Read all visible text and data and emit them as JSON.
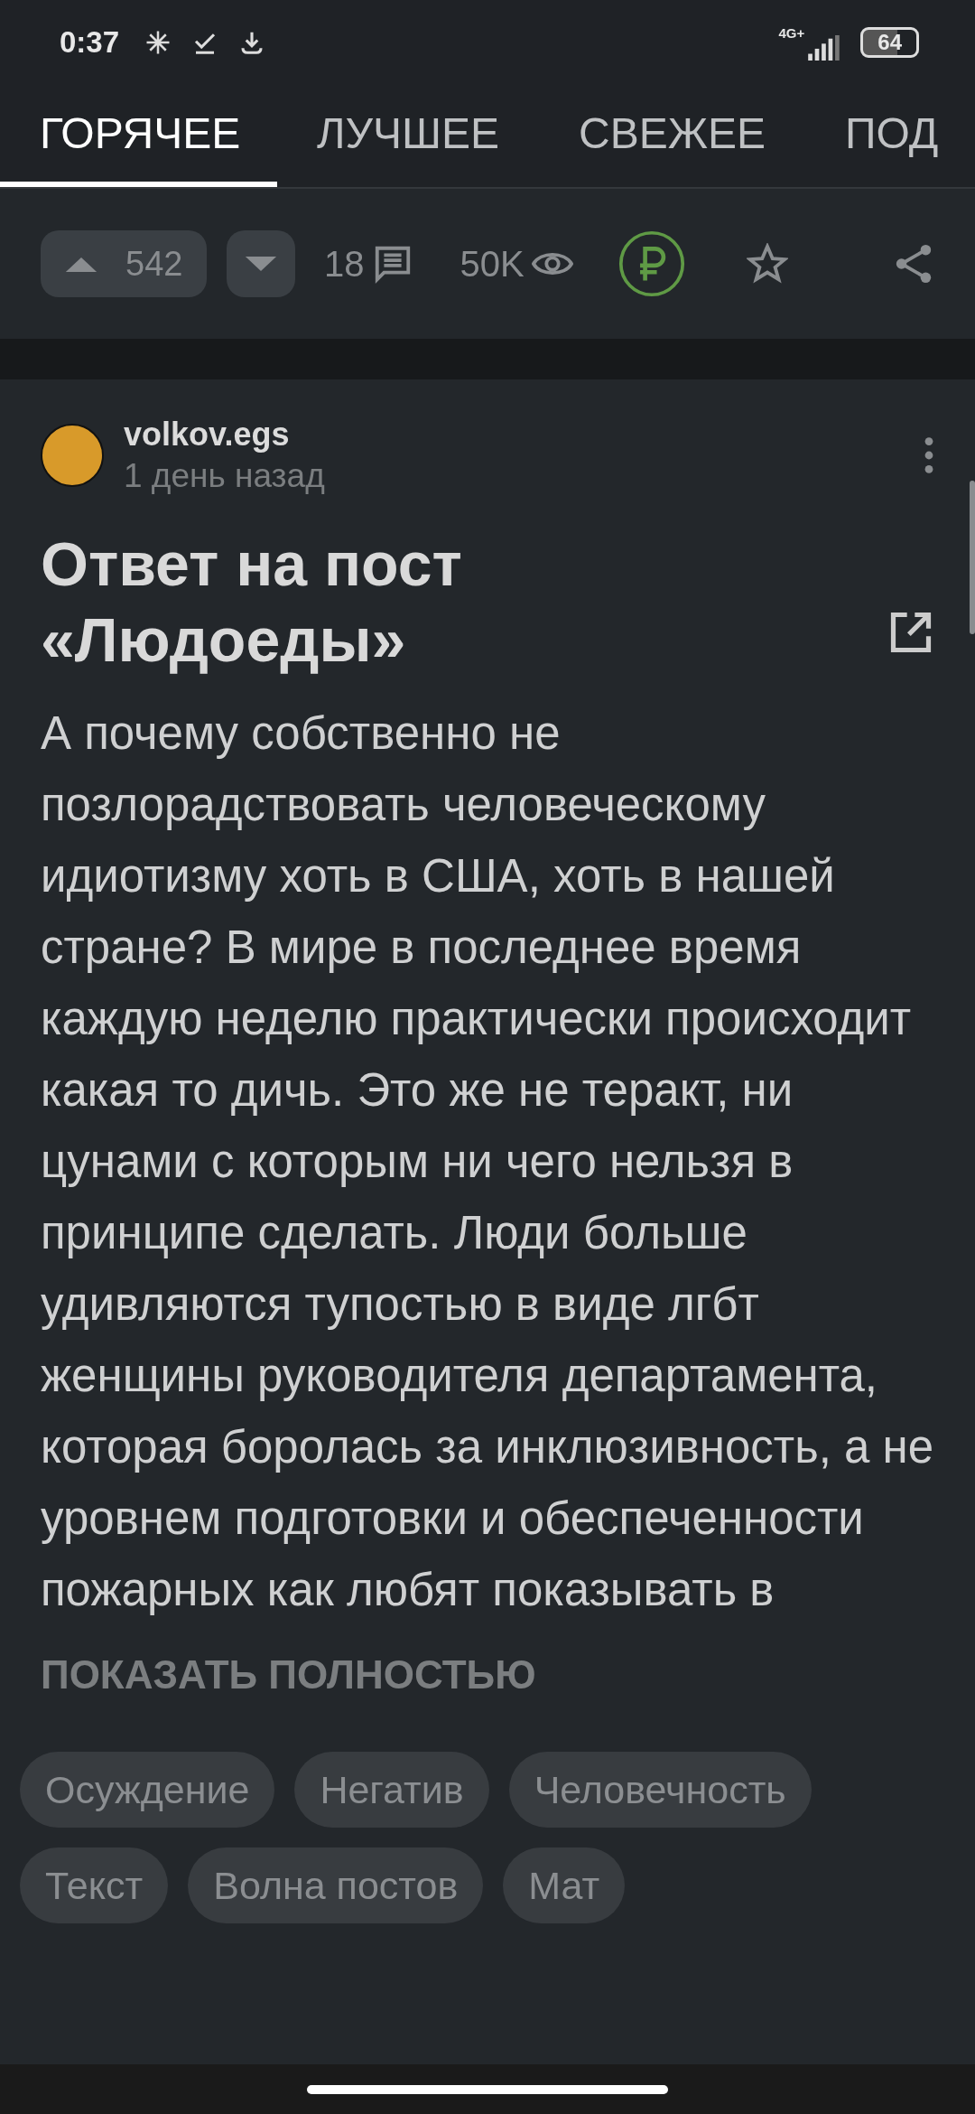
{
  "status_bar": {
    "time": "0:37",
    "network": "4G+",
    "battery": "64"
  },
  "tabs": [
    {
      "label": "ГОРЯЧЕЕ",
      "selected": true
    },
    {
      "label": "ЛУЧШЕЕ",
      "selected": false
    },
    {
      "label": "СВЕЖЕЕ",
      "selected": false
    },
    {
      "label": "ПОД",
      "selected": false
    }
  ],
  "prev_post_actions": {
    "rating": "542",
    "comments": "18",
    "views": "50K"
  },
  "post": {
    "author": "volkov.egs",
    "time": "1 день назад",
    "title": "Ответ на пост «Людоеды»",
    "body": "А почему собственно не позлорадствовать человеческому идиотизму хоть в США, хоть в нашей стране? В мире в последнее время каждую неделю практически происходит какая то дичь. Это же не теракт, ни цунами с которым ни чего нельзя в принципе сделать. Люди больше удивляются тупостью в виде лгбт женщины руководителя департамента, которая боролась за инклюзивность, а не уровнем подготовки и обеспеченности пожарных как любят показывать в",
    "show_more": "ПОКАЗАТЬ ПОЛНОСТЬЮ",
    "tags": [
      "Осуждение",
      "Негатив",
      "Человечность",
      "Текст",
      "Волна постов",
      "Мат"
    ]
  }
}
